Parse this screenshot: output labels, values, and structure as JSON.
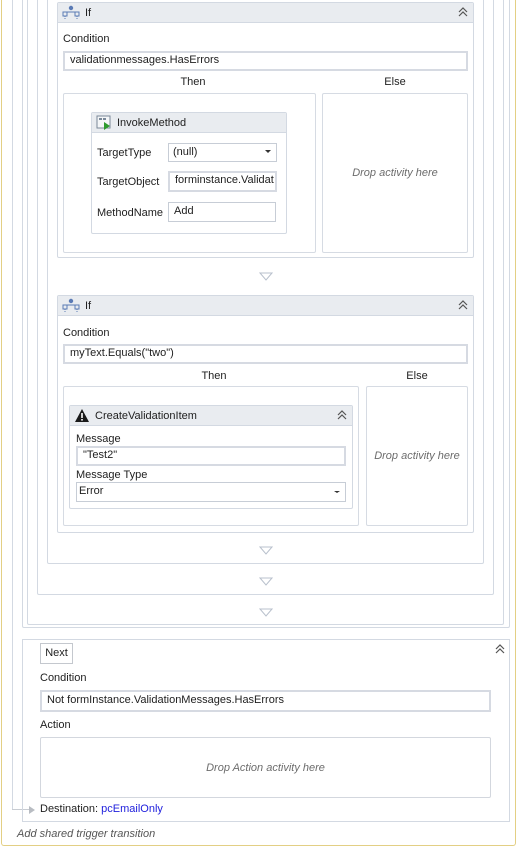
{
  "if1": {
    "title": "If",
    "condition_label": "Condition",
    "condition_value": "validationmessages.HasErrors",
    "then_label": "Then",
    "else_label": "Else",
    "else_placeholder": "Drop activity here",
    "invoke": {
      "title": "InvokeMethod",
      "target_type_label": "TargetType",
      "target_type_value": "(null)",
      "target_object_label": "TargetObject",
      "target_object_value": "forminstance.Validat",
      "method_name_label": "MethodName",
      "method_name_value": "Add"
    }
  },
  "if2": {
    "title": "If",
    "condition_label": "Condition",
    "condition_value": "myText.Equals(\"two\")",
    "then_label": "Then",
    "else_label": "Else",
    "else_placeholder": "Drop activity here",
    "create_item": {
      "title": "CreateValidationItem",
      "message_label": "Message",
      "message_value": "\"Test2\"",
      "message_type_label": "Message Type",
      "message_type_value": "Error"
    }
  },
  "transition": {
    "name": "Next",
    "condition_label": "Condition",
    "condition_value": "Not formInstance.ValidationMessages.HasErrors",
    "action_label": "Action",
    "action_placeholder": "Drop Action activity here",
    "destination_label": "Destination:",
    "destination_value": "pcEmailOnly"
  },
  "footer": {
    "add_shared_trigger": "Add shared trigger transition"
  },
  "colors": {
    "state_border": "#e3cf84",
    "frame_border": "#d3d9e2",
    "header_bg": "#e9ecf0",
    "link": "#2222dd"
  }
}
